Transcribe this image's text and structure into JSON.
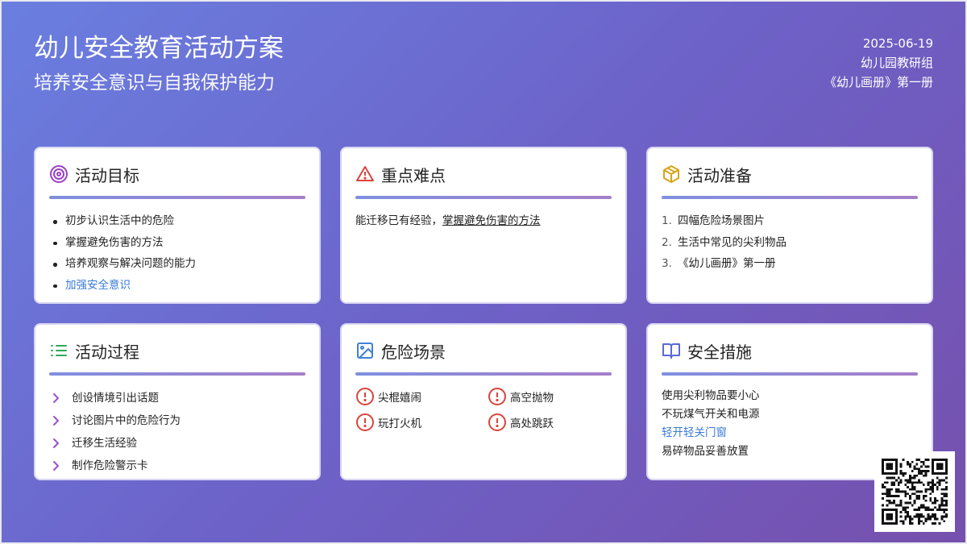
{
  "header": {
    "title": "幼儿安全教育活动方案",
    "subtitle": "培养安全意识与自我保护能力",
    "date": "2025-06-19",
    "author": "幼儿园教研组",
    "book": "《幼儿画册》第一册"
  },
  "cards": {
    "goals": {
      "title": "活动目标",
      "icon": "target-icon",
      "items": [
        "初步认识生活中的危险",
        "掌握避免伤害的方法",
        "培养观察与解决问题的能力",
        "加强安全意识"
      ]
    },
    "key_points": {
      "title": "重点难点",
      "icon": "warning-triangle-icon",
      "text_prefix": "能迁移已有经验，",
      "text_link": "掌握避免伤害的方法"
    },
    "preparation": {
      "title": "活动准备",
      "icon": "package-icon",
      "numbers": [
        "1.",
        "2.",
        "3."
      ],
      "items": [
        "四幅危险场景图片",
        "生活中常见的尖利物品",
        "《幼儿画册》第一册"
      ]
    },
    "process": {
      "title": "活动过程",
      "icon": "list-icon",
      "items": [
        "创设情境引出话题",
        "讨论图片中的危险行为",
        "迁移生活经验",
        "制作危险警示卡"
      ]
    },
    "scenes": {
      "title": "危险场景",
      "icon": "image-icon",
      "items": [
        "尖棍嬉闹",
        "高空抛物",
        "玩打火机",
        "高处跳跃"
      ]
    },
    "measures": {
      "title": "安全措施",
      "icon": "book-open-icon",
      "items": [
        "使用尖利物品要小心",
        "不玩煤气开关和电源",
        "轻开轻关门窗",
        "易碎物品妥善放置"
      ]
    }
  },
  "colors": {
    "accent_blue": "#3b7bd6",
    "target_purple": "#9b3fc8",
    "warning_red": "#d9443b",
    "package_yellow": "#d7a418",
    "list_green": "#2fa85a",
    "image_blue": "#3f80d6",
    "book_indigo": "#5a6ad6",
    "chevron_purple": "#9a4fd0",
    "alert_red": "#d9443b"
  }
}
